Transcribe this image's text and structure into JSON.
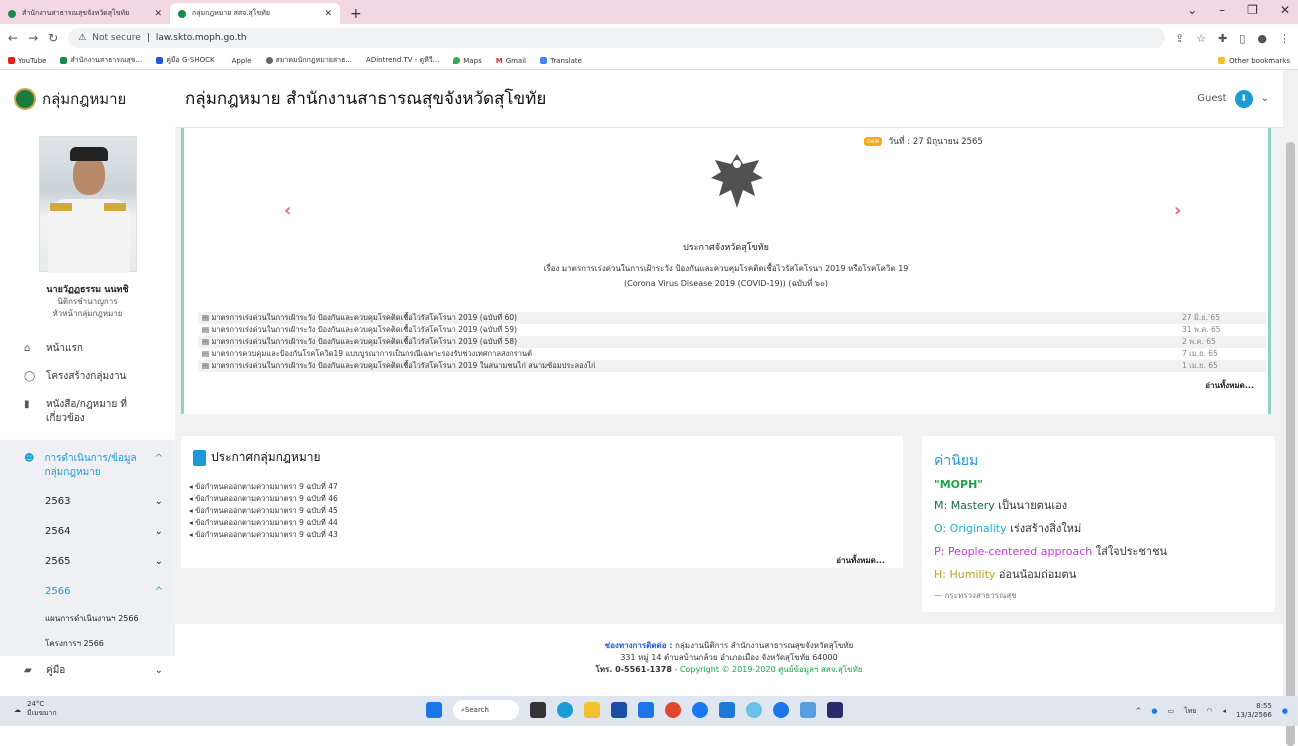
{
  "browser": {
    "tabs": [
      {
        "title": "สำนักงานสาธารณสุขจังหวัดสุโขทัย",
        "active": false
      },
      {
        "title": "กลุ่มกฎหมาย สสจ.สุโขทัย",
        "active": true
      }
    ],
    "url_security": "Not secure",
    "url": "law.skto.moph.go.th",
    "bookmarks": [
      "YouTube",
      "สำนักงานสาธารณสุข...",
      "คู่มือ G-SHOCK",
      "Apple",
      "สมาคมนักกฎหมายสาธ...",
      "ADintrend.TV - ดูทีวี...",
      "Maps",
      "Gmail",
      "Translate"
    ],
    "other_bookmarks": "Other bookmarks"
  },
  "sidebar": {
    "logo": "กลุ่มกฎหมาย",
    "person_name": "นายวัฏฏธรรม นนทชิ",
    "person_title1": "นิติกรชำนาญการ",
    "person_title2": "หัวหน้ากลุ่มกฎหมาย",
    "menu": [
      {
        "label": "หน้าแรก",
        "icon": "home-icon"
      },
      {
        "label": "โครงสร้างกลุ่มงาน",
        "icon": "org-icon"
      },
      {
        "label": "หนังสือ/กฎหมาย ที่เกี่ยวข้อง",
        "icon": "book-icon"
      }
    ],
    "section": "การดำเนินการ/ข้อมูลกลุ่มกฎหมาย",
    "years": [
      "2563",
      "2564",
      "2565",
      "2566"
    ],
    "sub_items": [
      "แผนการดำเนินงานฯ 2566",
      "โครงการฯ 2566"
    ],
    "manual": "คู่มือ"
  },
  "header": {
    "title": "กลุ่มกฎหมาย สำนักงานสาธารณสุขจังหวัดสุโขทัย",
    "user": "Guest"
  },
  "announcement": {
    "date": "วันที่ : 27 มิถุนายน 2565",
    "title": "ประกาศจังหวัดสุโขทัย",
    "subject1": "เรื่อง มาตรการเร่งด่วนในการเฝ้าระวัง ป้องกันและควบคุมโรคติดเชื้อไวรัสโคโรนา 2019 หรือโรคโควิด 19",
    "subject2": "(Corona Virus Disease 2019 (COVID-19)) (ฉบับที่ ๖๐)",
    "items": [
      {
        "text": "มาตรการเร่งด่วนในการเฝ้าระวัง ป้องกันและควบคุมโรคติดเชื้อไวรัสโคโรนา 2019 (ฉบับที่ 60)",
        "date": "27 มิ.ย. 65"
      },
      {
        "text": "มาตรการเร่งด่วนในการเฝ้าระวัง ป้องกันและควบคุมโรคติดเชื้อไวรัสโคโรนา 2019 (ฉบับที่ 59)",
        "date": "31 พ.ค. 65"
      },
      {
        "text": "มาตรการเร่งด่วนในการเฝ้าระวัง ป้องกันและควบคุมโรคติดเชื้อไวรัสโคโรนา 2019 (ฉบับที่ 58)",
        "date": "2 พ.ค. 65"
      },
      {
        "text": "มาตรการควบคุมและป้องกันโรคโควิด19 แบบบูรณาการเป็นกรณีเฉพาะรองรับช่วงเทศกาลสงกรานต์",
        "date": "7 เม.ย. 65"
      },
      {
        "text": "มาตรการเร่งด่วนในการเฝ้าระวัง ป้องกันและควบคุมโรคติดเชื้อไวรัสโคโรนา 2019 ในสนามชนไก่ สนามซ้อมประลองไก่",
        "date": "1 เม.ย. 65"
      }
    ],
    "read_all": "อ่านทั้งหมด..."
  },
  "notices": {
    "title": "ประกาศกลุ่มกฎหมาย",
    "items": [
      "ข้อกำหนดออกตามความมาตรา 9 ฉบับที่ 47",
      "ข้อกำหนดออกตามความมาตรา 9 ฉบับที่ 46",
      "ข้อกำหนดออกตามความมาตรา 9 ฉบับที่ 45",
      "ข้อกำหนดออกตามความมาตรา 9 ฉบับที่ 44",
      "ข้อกำหนดออกตามความมาตรา 9 ฉบับที่ 43"
    ],
    "read_all": "อ่านทั้งหมด..."
  },
  "values": {
    "title": "ค่านิยม",
    "quote": "\"MOPH\"",
    "lines": [
      {
        "key": "M: Mastery",
        "text": " เป็นนายตนเอง",
        "color": "#1b6a4a"
      },
      {
        "key": "O: Originality",
        "text": " เร่งสร้างสิ่งใหม่",
        "color": "#1bb0d6"
      },
      {
        "key": "P: People-centered approach",
        "text": " ใส่ใจประชาชน",
        "color": "#c43ad6"
      },
      {
        "key": "H: Humility",
        "text": " อ่อนน้อมถ่อมตน",
        "color": "#b9a020"
      }
    ],
    "source": "— กระทรวงสาธารณสุข"
  },
  "footer": {
    "contact_label": "ช่องทางการติดต่อ :",
    "contact": " กลุ่มงานนิติการ สำนักงานสาธารณสุขจังหวัดสุโขทัย",
    "address": "331 หมู่ 14 ตำบลบ้านกล้วย อำเภอเมือง จังหวัดสุโขทัย 64000",
    "tel": "โทร. 0-5561-1378",
    "copyright": " - Copyright © 2019-2020 ศูนย์ข้อมูลฯ สสจ.สุโขทัย"
  },
  "taskbar": {
    "temp": "24°C",
    "weather": "มีเมฆมาก",
    "search": "Search",
    "lang": "ไทย",
    "time": "8:55",
    "date": "13/3/2566"
  }
}
